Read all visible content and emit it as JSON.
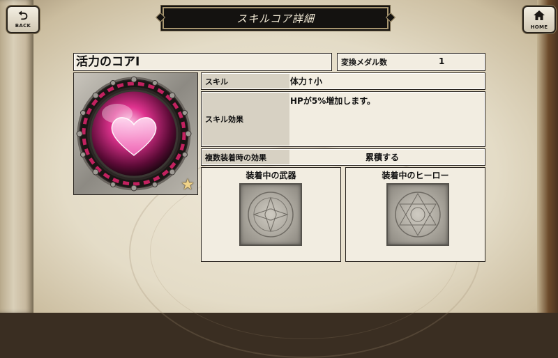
{
  "header": {
    "back_label": "BACK",
    "home_label": "HOME",
    "title": "スキルコア詳細"
  },
  "core": {
    "name": "活力のコアⅠ",
    "medal_label": "変換メダル数",
    "medal_value": "1",
    "rarity_icon": "star-icon",
    "gem_icon": "heart-gem-icon"
  },
  "details": {
    "skill_label": "スキル",
    "skill_value": "体力↑小",
    "effect_label": "スキル効果",
    "effect_value": "HPが5%増加します。",
    "multi_label": "複数装着時の効果",
    "multi_value": "累積する"
  },
  "equipped": {
    "weapon_label": "装着中の武器",
    "hero_label": "装着中のヒーロー"
  },
  "colors": {
    "gem_pink": "#e0338f",
    "title_bg": "#141210",
    "panel_bg": "#f2ede1",
    "label_bg": "#d7d1c3"
  }
}
